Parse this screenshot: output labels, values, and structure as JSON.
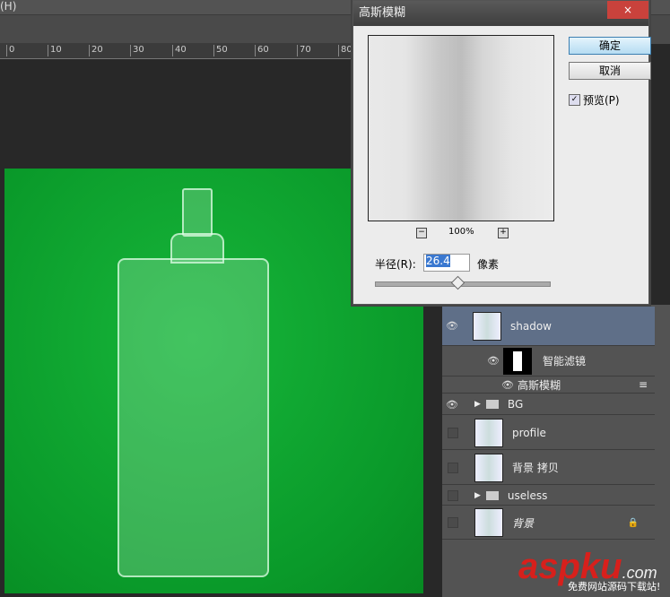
{
  "menubar": {
    "item": "(H)"
  },
  "ruler": {
    "ticks": [
      "0",
      "10",
      "20",
      "30",
      "40",
      "50",
      "60",
      "70",
      "80"
    ]
  },
  "dialog": {
    "title": "高斯模糊",
    "ok": "确定",
    "cancel": "取消",
    "preview_label": "预览(P)",
    "preview_checked": true,
    "zoom": "100%",
    "radius_label": "半径(R):",
    "radius_value": "26.4",
    "unit": "像素",
    "slider_fraction": 0.47,
    "close": "×"
  },
  "layers": [
    {
      "name": "shadow",
      "visible": true,
      "selected": true
    },
    {
      "name": "智能滤镜",
      "visible": true
    },
    {
      "name": "高斯模糊",
      "visible": true
    },
    {
      "name": "BG",
      "visible": true,
      "group": true
    },
    {
      "name": "profile",
      "visible": false
    },
    {
      "name": "背景 拷贝",
      "visible": false
    },
    {
      "name": "useless",
      "visible": false,
      "group": true
    },
    {
      "name": "背景",
      "visible": false,
      "locked": true
    }
  ],
  "watermark": {
    "brand": "aspku",
    "tld": ".com",
    "slogan": "免费网站源码下载站!"
  }
}
